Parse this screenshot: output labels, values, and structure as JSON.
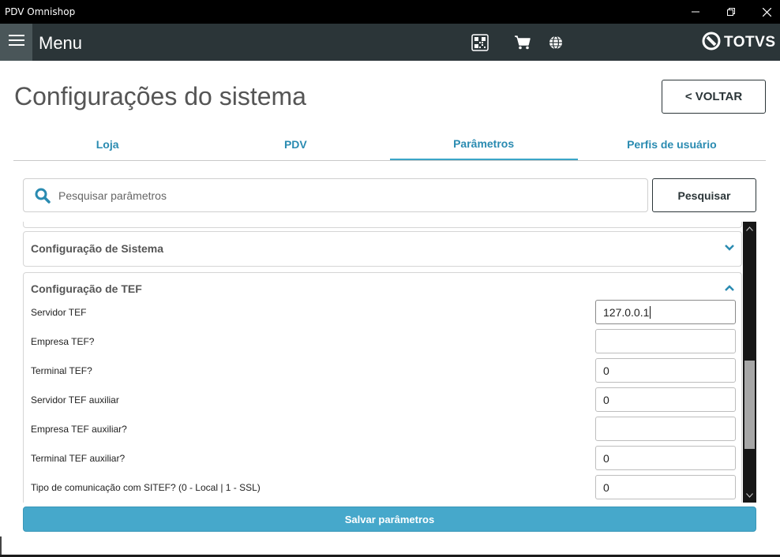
{
  "window": {
    "title": "PDV Omnishop",
    "controls": [
      "minimize-icon",
      "restore-icon",
      "close-icon"
    ]
  },
  "header": {
    "menu_label": "Menu",
    "icons": [
      "qr-code-icon",
      "cart-icon",
      "globe-icon"
    ],
    "brand": "TOTVS"
  },
  "page": {
    "title": "Configurações do sistema",
    "back_label": "<  VOLTAR"
  },
  "tabs": [
    {
      "label": "Loja",
      "active": false
    },
    {
      "label": "PDV",
      "active": false
    },
    {
      "label": "Parâmetros",
      "active": true
    },
    {
      "label": "Perfis de usuário",
      "active": false
    }
  ],
  "search": {
    "placeholder": "Pesquisar parâmetros",
    "value": "",
    "button_label": "Pesquisar"
  },
  "sections": [
    {
      "title": "Configuração de Sistema",
      "expanded": false
    },
    {
      "title": "Configuração de TEF",
      "expanded": true,
      "params": [
        {
          "label": "Servidor TEF",
          "value": "127.0.0.1"
        },
        {
          "label": "Empresa TEF?",
          "value": ""
        },
        {
          "label": "Terminal TEF?",
          "value": "0"
        },
        {
          "label": "Servidor TEF auxiliar",
          "value": "0"
        },
        {
          "label": "Empresa TEF auxiliar?",
          "value": ""
        },
        {
          "label": "Terminal TEF auxiliar?",
          "value": "0"
        },
        {
          "label": "Tipo de comunicação com SITEF? (0 - Local | 1 - SSL)",
          "value": "0"
        }
      ]
    }
  ],
  "save_label": "Salvar parâmetros",
  "colors": {
    "titlebar": "#000000",
    "header": "#2b3538",
    "accent": "#46a8cb",
    "tab_text": "#2a8bb1"
  }
}
